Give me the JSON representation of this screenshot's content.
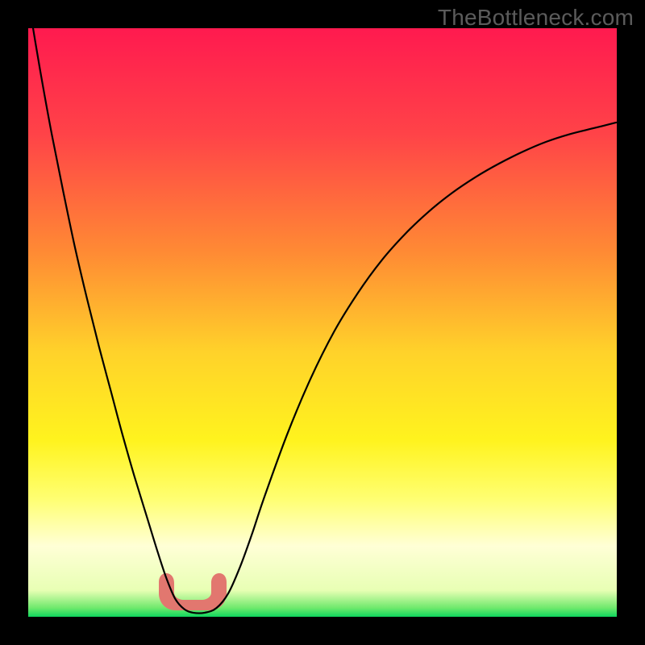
{
  "watermark": "TheBottleneck.com",
  "chart_data": {
    "type": "line",
    "title": "",
    "xlabel": "",
    "ylabel": "",
    "xlim": [
      0,
      100
    ],
    "ylim": [
      0,
      100
    ],
    "grid": false,
    "legend": false,
    "background": {
      "kind": "vertical-gradient",
      "stops": [
        {
          "pos": 0.0,
          "color": "#ff1a4f"
        },
        {
          "pos": 0.18,
          "color": "#ff4348"
        },
        {
          "pos": 0.38,
          "color": "#ff8a34"
        },
        {
          "pos": 0.55,
          "color": "#ffd22a"
        },
        {
          "pos": 0.7,
          "color": "#fff31e"
        },
        {
          "pos": 0.8,
          "color": "#ffff72"
        },
        {
          "pos": 0.88,
          "color": "#ffffd6"
        },
        {
          "pos": 0.955,
          "color": "#e8ffb4"
        },
        {
          "pos": 0.985,
          "color": "#6fe96c"
        },
        {
          "pos": 1.0,
          "color": "#0fd65e"
        }
      ]
    },
    "series": [
      {
        "name": "bottleneck-curve",
        "stroke": "#000000",
        "stroke_width": 2.2,
        "x": [
          0.0,
          2.0,
          4.0,
          6.0,
          8.0,
          10.0,
          12.0,
          14.0,
          16.0,
          18.0,
          20.0,
          22.0,
          23.5,
          25.0,
          26.5,
          28.0,
          30.0,
          32.0,
          34.0,
          36.0,
          38.0,
          40.0,
          44.0,
          48.0,
          52.0,
          56.0,
          60.0,
          64.0,
          68.0,
          72.0,
          76.0,
          80.0,
          84.0,
          88.0,
          92.0,
          96.0,
          100.0
        ],
        "y": [
          105.0,
          93.0,
          82.0,
          72.0,
          62.5,
          54.0,
          46.0,
          38.5,
          31.0,
          24.0,
          17.5,
          11.0,
          6.5,
          3.0,
          1.3,
          0.7,
          0.7,
          1.5,
          4.0,
          8.5,
          14.0,
          20.0,
          31.0,
          40.5,
          48.5,
          55.0,
          60.5,
          65.0,
          68.8,
          72.0,
          74.7,
          77.0,
          79.0,
          80.7,
          82.0,
          83.0,
          84.0
        ]
      }
    ],
    "annotations": [
      {
        "name": "trough-highlight",
        "shape": "u-blob",
        "color": "#e2776f",
        "approx_x_range": [
          23,
          32
        ],
        "approx_y_range": [
          0.5,
          7
        ],
        "note": "rounded blob marking curve minimum"
      }
    ]
  }
}
